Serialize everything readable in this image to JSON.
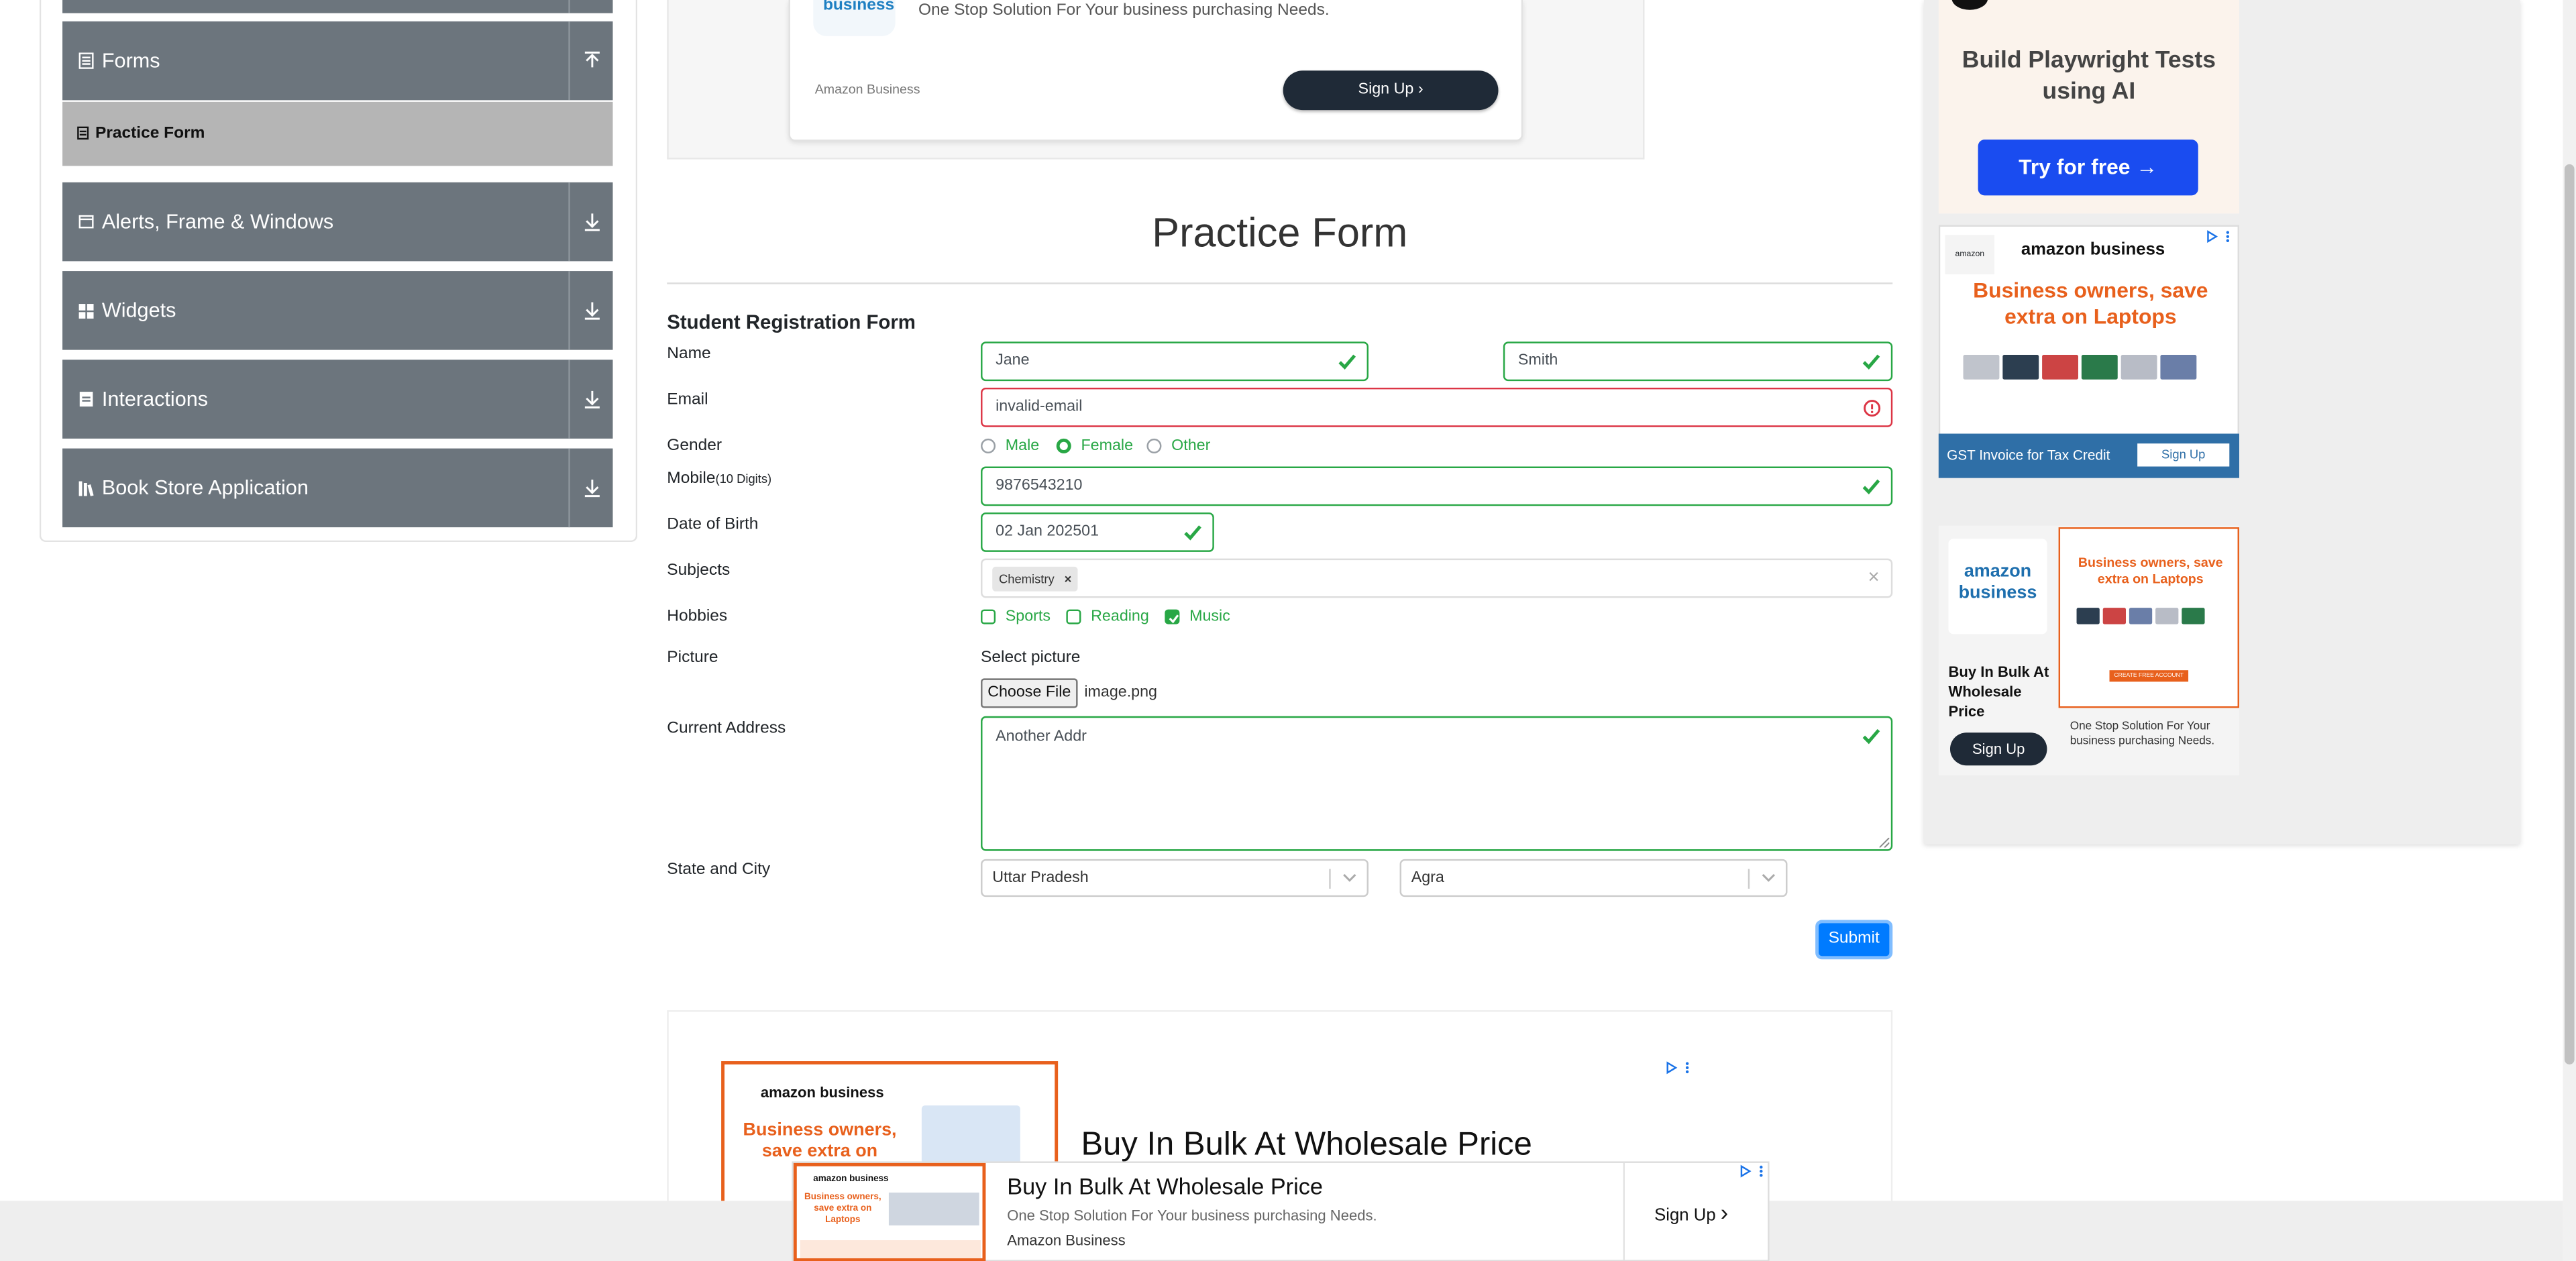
{
  "sidebar": {
    "groups": [
      {
        "label": "Forms"
      },
      {
        "label": "Alerts, Frame & Windows"
      },
      {
        "label": "Widgets"
      },
      {
        "label": "Interactions"
      },
      {
        "label": "Book Store Application"
      }
    ],
    "active_item": "Practice Form"
  },
  "top_ad": {
    "logo_text": "business",
    "tagline": "One Stop Solution For Your business purchasing Needs.",
    "advertiser": "Amazon Business",
    "button": "Sign Up"
  },
  "form": {
    "page_title": "Practice Form",
    "section_title": "Student Registration Form",
    "labels": {
      "name": "Name",
      "email": "Email",
      "gender": "Gender",
      "mobile": "Mobile",
      "mobile_hint": "(10 Digits)",
      "dob": "Date of Birth",
      "subjects": "Subjects",
      "hobbies": "Hobbies",
      "picture": "Picture",
      "address": "Current Address",
      "state_city": "State and City"
    },
    "first_name": "Jane",
    "last_name": "Smith",
    "email": "invalid-email",
    "gender_options": [
      "Male",
      "Female",
      "Other"
    ],
    "gender_selected": "Female",
    "mobile": "9876543210",
    "dob": "02 Jan 202501",
    "subject_tag": "Chemistry",
    "hobby_options": [
      "Sports",
      "Reading",
      "Music"
    ],
    "hobbies_checked": [
      "Music"
    ],
    "picture_label": "Select picture",
    "choose_file": "Choose File",
    "file_name": "image.png",
    "address": "Another Addr",
    "state": "Uttar Pradesh",
    "city": "Agra",
    "submit": "Submit"
  },
  "right_ads": {
    "zerostep_heading": "Build Playwright Tests using AI",
    "zerostep_button": "Try for free →",
    "amazon_logo": "amazon business",
    "amazon_headline": "Business owners, save extra on Laptops",
    "amazon_footer": "GST Invoice for Tax Credit",
    "amazon_footer_btn": "Sign Up",
    "amazon2_logo": "amazon business",
    "amazon2_text": "Buy In Bulk At Wholesale Price",
    "amazon2_btn": "Sign Up",
    "amazon2_headline": "Business owners, save extra on Laptops",
    "amazon2_tagline": "One Stop Solution For Your business purchasing Needs.",
    "create_account": "CREATE FREE ACCOUNT"
  },
  "bottom_ad": {
    "logo": "amazon business",
    "headline_img": "Business owners, save extra on Apple",
    "title": "Buy In Bulk At Wholesale Price"
  },
  "sticky_ad": {
    "logo": "amazon business",
    "img_text": "Business owners, save extra on Laptops",
    "title": "Buy In Bulk At Wholesale Price",
    "tagline": "One Stop Solution For Your business purchasing Needs.",
    "advertiser": "Amazon Business",
    "button": "Sign Up"
  },
  "colors": {
    "valid": "#28a745",
    "invalid": "#dc3545",
    "primary": "#007bff",
    "sidebar": "#6c757d",
    "amazon_orange": "#e8601c"
  }
}
